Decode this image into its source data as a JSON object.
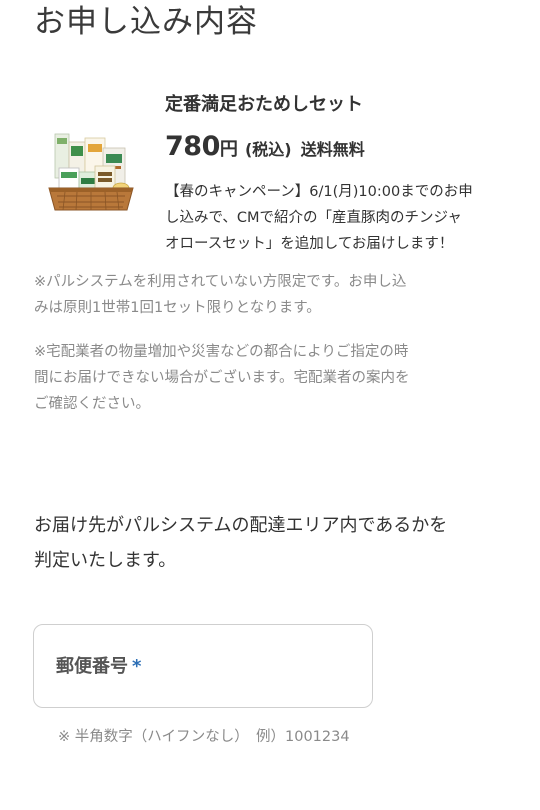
{
  "page": {
    "title": "お申し込み内容"
  },
  "product": {
    "name": "定番満足おためしセット",
    "price_amount": "780",
    "price_unit": "円",
    "price_tax": "(税込)",
    "shipping": "送料無料",
    "campaign_lines": [
      "【春のキャンペーン】6/1(月)10:00までのお申",
      "し込みで、CMで紹介の「産直豚肉のチンジャ",
      "オロースセット」を追加してお届けします！"
    ]
  },
  "notes": [
    {
      "lines": [
        "※パルシステムを利用されていない方限定です。お申し込",
        "みは原則1世帯1回1セット限りとなります。"
      ]
    },
    {
      "lines": [
        "※宅配業者の物量増加や災害などの都合によりご指定の時",
        "間にお届けできない場合がございます。宅配業者の案内を",
        "ご確認ください。"
      ]
    }
  ],
  "delivery_check": {
    "lines": [
      "お届け先がパルシステムの配達エリア内であるかを",
      "判定いたします。"
    ]
  },
  "postal_field": {
    "label": "郵便番号",
    "required_mark": "*",
    "hint": "※ 半角数字（ハイフンなし）　例）1001234"
  },
  "colors": {
    "text": "#333333",
    "muted": "#8a8a8a",
    "required": "#2a6db5",
    "field_border": "#cfcfcf"
  }
}
